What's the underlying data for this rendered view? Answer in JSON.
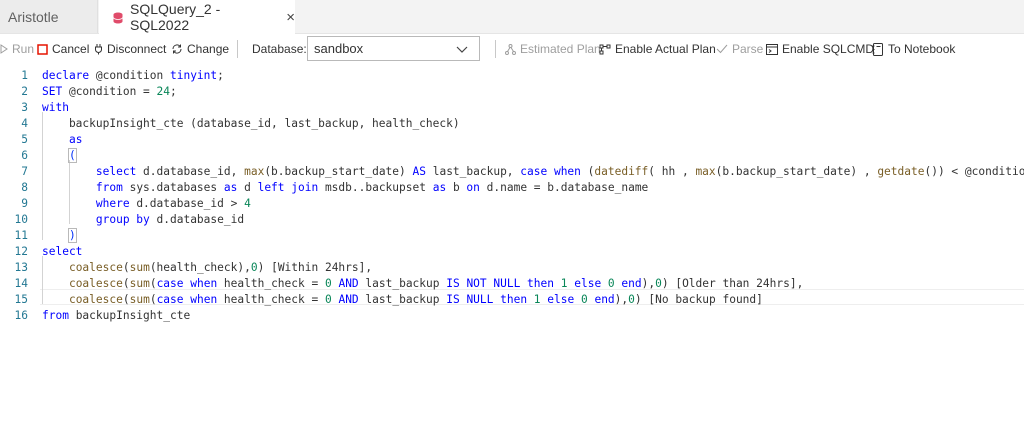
{
  "tabs": [
    {
      "label": "Aristotle"
    },
    {
      "label": "SQLQuery_2 - SQL2022",
      "close": "×"
    }
  ],
  "toolbar": {
    "run": "Run",
    "cancel": "Cancel",
    "disconnect": "Disconnect",
    "change": "Change",
    "database_label": "Database:",
    "database_value": "sandbox",
    "estimated_plan": "Estimated Plan",
    "enable_actual_plan": "Enable Actual Plan",
    "parse": "Parse",
    "enable_sqlcmd": "Enable SQLCMD",
    "to_notebook": "To Notebook"
  },
  "colors": {
    "keyword": "#0000ff",
    "function": "#795e26",
    "number": "#098658",
    "line_number": "#237893",
    "cancel": "#e51400"
  },
  "editor": {
    "lines": [
      {
        "n": "1",
        "tokens": [
          [
            "kw",
            "declare "
          ],
          [
            "id",
            "@condition "
          ],
          [
            "kw",
            "tinyint"
          ],
          [
            "id",
            ";"
          ]
        ]
      },
      {
        "n": "2",
        "tokens": [
          [
            "kw",
            "SET "
          ],
          [
            "id",
            "@condition = "
          ],
          [
            "num",
            "24"
          ],
          [
            "id",
            ";"
          ]
        ]
      },
      {
        "n": "3",
        "tokens": [
          [
            "kw",
            "with"
          ]
        ]
      },
      {
        "n": "4",
        "tokens": [
          [
            "id",
            "    backupInsight_cte (database_id, last_backup, health_check)"
          ]
        ]
      },
      {
        "n": "5",
        "tokens": [
          [
            "id",
            "    "
          ],
          [
            "kw",
            "as"
          ]
        ]
      },
      {
        "n": "6",
        "tokens": [
          [
            "id",
            "    "
          ],
          [
            "brk",
            "("
          ]
        ]
      },
      {
        "n": "7",
        "tokens": [
          [
            "id",
            "        "
          ],
          [
            "kw",
            "select "
          ],
          [
            "id",
            "d.database_id, "
          ],
          [
            "fn",
            "max"
          ],
          [
            "id",
            "(b.backup_start_date) "
          ],
          [
            "kw",
            "AS "
          ],
          [
            "id",
            "last_backup, "
          ],
          [
            "kw",
            "case when "
          ],
          [
            "id",
            "("
          ],
          [
            "fn",
            "datediff"
          ],
          [
            "id",
            "( hh , "
          ],
          [
            "fn",
            "max"
          ],
          [
            "id",
            "(b.backup_start_date) , "
          ],
          [
            "fn",
            "getdate"
          ],
          [
            "id",
            "()) < @condition"
          ]
        ]
      },
      {
        "n": "8",
        "tokens": [
          [
            "id",
            "        "
          ],
          [
            "kw",
            "from "
          ],
          [
            "id",
            "sys.databases "
          ],
          [
            "kw",
            "as "
          ],
          [
            "id",
            "d "
          ],
          [
            "kw",
            "left join "
          ],
          [
            "id",
            "msdb..backupset "
          ],
          [
            "kw",
            "as "
          ],
          [
            "id",
            "b "
          ],
          [
            "kw",
            "on "
          ],
          [
            "id",
            "d.name = b.database_name"
          ]
        ]
      },
      {
        "n": "9",
        "tokens": [
          [
            "id",
            "        "
          ],
          [
            "kw",
            "where "
          ],
          [
            "id",
            "d.database_id > "
          ],
          [
            "num",
            "4"
          ]
        ]
      },
      {
        "n": "10",
        "tokens": [
          [
            "id",
            "        "
          ],
          [
            "kw",
            "group by "
          ],
          [
            "id",
            "d.database_id"
          ]
        ]
      },
      {
        "n": "11",
        "tokens": [
          [
            "id",
            "    "
          ],
          [
            "brk",
            ")"
          ]
        ]
      },
      {
        "n": "12",
        "tokens": [
          [
            "kw",
            "select"
          ]
        ]
      },
      {
        "n": "13",
        "tokens": [
          [
            "id",
            "    "
          ],
          [
            "fn",
            "coalesce"
          ],
          [
            "id",
            "("
          ],
          [
            "fn",
            "sum"
          ],
          [
            "id",
            "(health_check),"
          ],
          [
            "num",
            "0"
          ],
          [
            "id",
            ") [Within 24hrs],"
          ]
        ]
      },
      {
        "n": "14",
        "tokens": [
          [
            "id",
            "    "
          ],
          [
            "fn",
            "coalesce"
          ],
          [
            "id",
            "("
          ],
          [
            "fn",
            "sum"
          ],
          [
            "id",
            "("
          ],
          [
            "kw",
            "case when "
          ],
          [
            "id",
            "health_check = "
          ],
          [
            "num",
            "0 "
          ],
          [
            "kw",
            "AND "
          ],
          [
            "id",
            "last_backup "
          ],
          [
            "kw",
            "IS NOT NULL then "
          ],
          [
            "num",
            "1 "
          ],
          [
            "kw",
            "else "
          ],
          [
            "num",
            "0 "
          ],
          [
            "kw",
            "end"
          ],
          [
            "id",
            "),"
          ],
          [
            "num",
            "0"
          ],
          [
            "id",
            ") [Older than 24hrs],"
          ]
        ]
      },
      {
        "n": "15",
        "tokens": [
          [
            "id",
            "    "
          ],
          [
            "fn",
            "coalesce"
          ],
          [
            "id",
            "("
          ],
          [
            "fn",
            "sum"
          ],
          [
            "id",
            "("
          ],
          [
            "kw",
            "case when "
          ],
          [
            "id",
            "health_check = "
          ],
          [
            "num",
            "0 "
          ],
          [
            "kw",
            "AND "
          ],
          [
            "id",
            "last_backup "
          ],
          [
            "kw",
            "IS NULL then "
          ],
          [
            "num",
            "1 "
          ],
          [
            "kw",
            "else "
          ],
          [
            "num",
            "0 "
          ],
          [
            "kw",
            "end"
          ],
          [
            "id",
            "),"
          ],
          [
            "num",
            "0"
          ],
          [
            "id",
            ") [No backup found]"
          ]
        ]
      },
      {
        "n": "16",
        "tokens": [
          [
            "kw",
            "from "
          ],
          [
            "id",
            "backupInsight_cte"
          ]
        ]
      }
    ]
  }
}
